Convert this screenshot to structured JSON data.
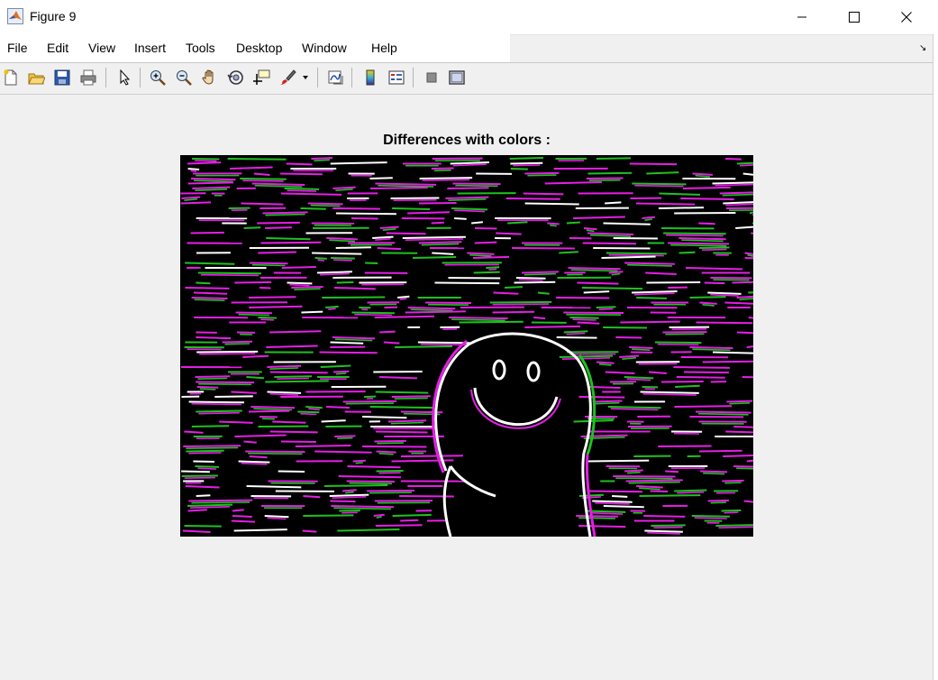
{
  "window": {
    "title": "Figure 9"
  },
  "menu": [
    "File",
    "Edit",
    "View",
    "Insert",
    "Tools",
    "Desktop",
    "Window",
    "Help"
  ],
  "figure": {
    "title": "Differences with colors :"
  }
}
